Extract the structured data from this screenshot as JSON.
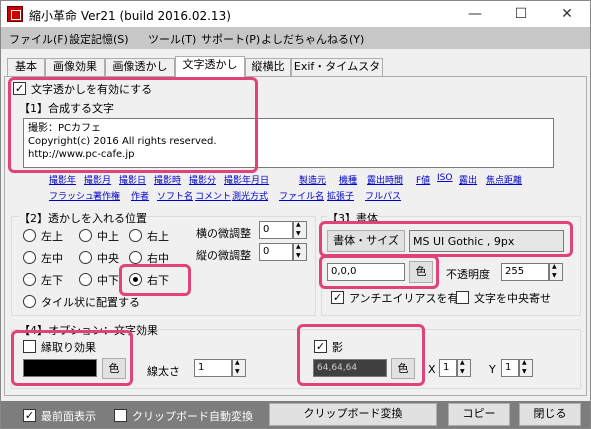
{
  "window": {
    "title": "縮小革命 Ver21  (build 2016.02.13)",
    "minimize": "—",
    "maximize": "☐",
    "close": "✕"
  },
  "menu": [
    "ファイル(F)",
    "設定記憶(S)",
    "ツール(T)",
    "サポート(P)",
    "よしだちゃんねる(Y)"
  ],
  "tabs": [
    "基本",
    "画像効果",
    "画像透かし",
    "文字透かし",
    "縦横比",
    "Exif・タイムスタンプ"
  ],
  "active_tab": "文字透かし",
  "enable": {
    "label": "文字透かしを有効にする",
    "checked": true
  },
  "compose": {
    "header": "【1】合成する文字",
    "text": "撮影：PCカフェ\nCopyright(c) 2016 All rights reserved.\nhttp://www.pc-cafe.jp"
  },
  "tags_row1": [
    "撮影年",
    "撮影月",
    "撮影日",
    "撮影時",
    "撮影分",
    "撮影年月日",
    "製造元",
    "機種",
    "露出時間",
    "F値",
    "ISO",
    "露出",
    "焦点距離"
  ],
  "tags_row2": [
    "フラッシュ",
    "著作権",
    "作者",
    "ソフト名",
    "コメント",
    "測光方式",
    "ファイル名",
    "拡張子",
    "フルパス"
  ],
  "position": {
    "header": "【2】透かしを入れる位置",
    "options": [
      "左上",
      "中上",
      "右上",
      "左中",
      "中央",
      "右中",
      "左下",
      "中下",
      "右下"
    ],
    "selected": "右下",
    "tile_label": "タイル状に配置する",
    "h_adjust_label": "横の微調整",
    "h_adjust_value": "0",
    "v_adjust_label": "縦の微調整",
    "v_adjust_value": "0"
  },
  "font": {
    "header": "【3】書体",
    "button": "書体・サイズ",
    "value": "MS UI Gothic , 9px",
    "color_value": "0,0,0",
    "color_button": "色",
    "opacity_label": "不透明度",
    "opacity_value": "255",
    "antialias_label": "アンチエイリアスを有効",
    "antialias_checked": true,
    "center_label": "文字を中央寄せ",
    "center_checked": false
  },
  "options": {
    "header": "【4】オプション：文字効果",
    "outline_label": "縁取り効果",
    "outline_checked": false,
    "outline_color_button": "色",
    "outline_color_hex": "#000000",
    "width_label": "線太さ",
    "width_value": "1",
    "shadow_label": "影",
    "shadow_checked": true,
    "shadow_color_value": "64,64,64",
    "shadow_color_hex": "#404040",
    "shadow_color_button": "色",
    "x_label": "X",
    "x_value": "1",
    "y_label": "Y",
    "y_value": "1"
  },
  "bottom": {
    "topmost_label": "最前面表示",
    "topmost_checked": true,
    "clipboard_auto_label": "クリップボード自動変換",
    "clipboard_auto_checked": false,
    "clipboard_convert_button": "クリップボード変換",
    "copy_button": "コピー",
    "close_button": "閉じる"
  },
  "colors": {
    "highlight": "#e0427a",
    "statusbar": "#7d7d7d",
    "link": "#0000cc"
  }
}
